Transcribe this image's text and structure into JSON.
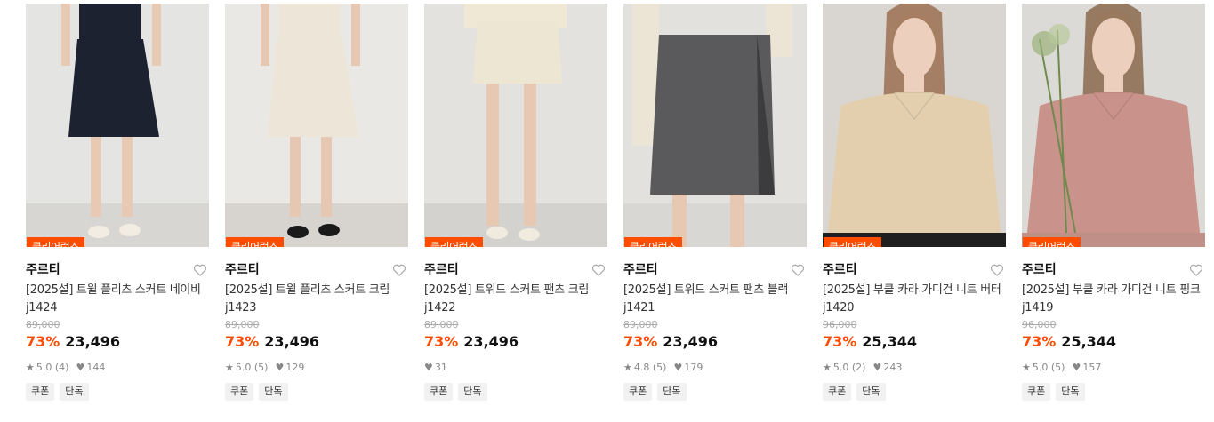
{
  "products": [
    {
      "badge": "클리어런스",
      "brand": "주르티",
      "title": "[2025설] 트윌 플리츠 스커트 네이비 j1424",
      "original_price": "89,000",
      "discount": "73%",
      "price": "23,496",
      "rating": "5.0 (4)",
      "likes": "144",
      "tags": [
        "쿠폰",
        "단독"
      ],
      "image": {
        "kind": "skirt-pleat",
        "bg": "#e4e4e2",
        "floor": "#d8d6d2",
        "garment": "#1c2230",
        "skin": "#e8c9b4",
        "shoe": "#f2ece2"
      }
    },
    {
      "badge": "클리어런스",
      "brand": "주르티",
      "title": "[2025설] 트윌 플리츠 스커트 크림 j1423",
      "original_price": "89,000",
      "discount": "73%",
      "price": "23,496",
      "rating": "5.0 (5)",
      "likes": "129",
      "tags": [
        "쿠폰",
        "단독"
      ],
      "image": {
        "kind": "skirt-pleat",
        "bg": "#e9e8e5",
        "floor": "#d7d4cf",
        "garment": "#ede6d8",
        "skin": "#e6c7b2",
        "shoe": "#1a1a1a"
      }
    },
    {
      "badge": "클리어런스",
      "brand": "주르티",
      "title": "[2025설] 트위드 스커트 팬츠 크림 j1422",
      "original_price": "89,000",
      "discount": "73%",
      "price": "23,496",
      "rating": "",
      "likes": "31",
      "tags": [
        "쿠폰",
        "단독"
      ],
      "image": {
        "kind": "skirt-mini",
        "bg": "#e3e2df",
        "floor": "#d4d2ce",
        "garment": "#ece6d2",
        "skin": "#e7c8b3",
        "shoe": "#f1ebdf"
      }
    },
    {
      "badge": "클리어런스",
      "brand": "주르티",
      "title": "[2025설] 트위드 스커트 팬츠 블랙 j1421",
      "original_price": "89,000",
      "discount": "73%",
      "price": "23,496",
      "rating": "4.8 (5)",
      "likes": "179",
      "tags": [
        "쿠폰",
        "단독"
      ],
      "image": {
        "kind": "skirt-tweed",
        "bg": "#e2e1de",
        "floor": "#d9d7d3",
        "garment": "#5a5a5c",
        "skin": "#e7c8b3",
        "shoe": "#eee"
      }
    },
    {
      "badge": "클리어런스",
      "brand": "주르티",
      "title": "[2025설] 부클 카라 가디건 니트 버터 j1420",
      "original_price": "96,000",
      "discount": "73%",
      "price": "25,344",
      "rating": "5.0 (2)",
      "likes": "243",
      "tags": [
        "쿠폰",
        "단독"
      ],
      "image": {
        "kind": "knit",
        "bg": "#d9d6d1",
        "floor": "#1f1f1f",
        "garment": "#e3cfae",
        "skin": "#ecd0bd",
        "shoe": "#9a7052"
      }
    },
    {
      "badge": "클리어런스",
      "brand": "주르티",
      "title": "[2025설] 부클 카라 가디건 니트 핑크 j1419",
      "original_price": "96,000",
      "discount": "73%",
      "price": "25,344",
      "rating": "5.0 (5)",
      "likes": "157",
      "tags": [
        "쿠폰",
        "단독"
      ],
      "image": {
        "kind": "knit-flowers",
        "bg": "#dcdad6",
        "floor": "#c08f88",
        "garment": "#c9928a",
        "skin": "#ecd0bd",
        "shoe": "#8a6a4e"
      }
    }
  ]
}
